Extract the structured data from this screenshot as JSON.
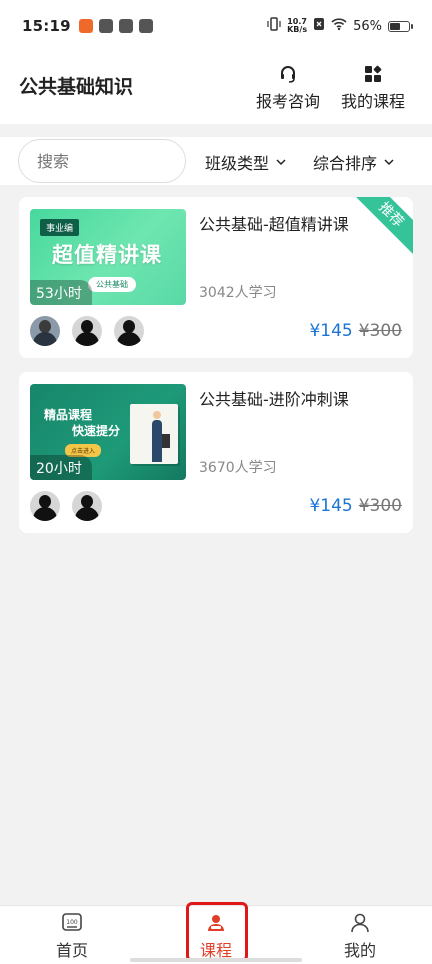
{
  "status_bar": {
    "time": "15:19",
    "net_speed_value": "10.7",
    "net_speed_unit": "KB/s",
    "battery_text": "56%",
    "battery_level_percent": 56
  },
  "header": {
    "title": "公共基础知识",
    "consult_label": "报考咨询",
    "my_courses_label": "我的课程"
  },
  "filters": {
    "search_placeholder": "搜索",
    "class_type_label": "班级类型",
    "sort_label": "综合排序"
  },
  "courses": [
    {
      "title": "公共基础-超值精讲课",
      "learners": "3042人学习",
      "price": "¥145",
      "original_price": "¥300",
      "ribbon": "推荐",
      "thumb_tag": "事业编",
      "thumb_title": "超值精讲课",
      "thumb_pill": "公共基础",
      "hours": "53小时"
    },
    {
      "title": "公共基础-进阶冲刺课",
      "learners": "3670人学习",
      "price": "¥145",
      "original_price": "¥300",
      "thumb_line1": "精品课程",
      "thumb_line2": "快速提分",
      "thumb_button": "点击进入",
      "hours": "20小时"
    }
  ],
  "bottom_nav": {
    "home": "首页",
    "courses": "课程",
    "mine": "我的"
  },
  "colors": {
    "accent_active": "#e0402a",
    "price_blue": "#1a74d4",
    "ribbon_green": "#35c49a",
    "highlight_red": "#e01818"
  }
}
